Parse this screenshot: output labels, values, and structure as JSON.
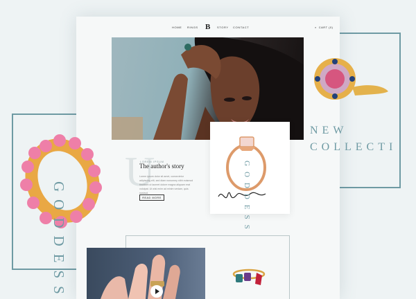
{
  "decor": {
    "vertical_big": "GODDESS",
    "vertical_small": "GODDESS",
    "new_collection_line1": "NEW",
    "new_collection_line2": "COLLECTI"
  },
  "nav": {
    "items": [
      "HOME",
      "RINGS",
      "STORY",
      "CONTACT"
    ],
    "logo": "B",
    "cart": "CART (0)"
  },
  "story": {
    "big_letter": "U",
    "caption": "LOREM IPSUM",
    "title": "The author's story",
    "body": "Lorem ipsum dolor sit amet, consectetur adipiscing elit, sed diam nonummy nibh euismod tincidunt ut laoreet dolore magna aliquam erat volutpat. Ut wisi enim ad minim veniam, quis nostrud.",
    "read_more": "READ MORE"
  },
  "colors": {
    "accent": "#6e9aa3",
    "gold": "#e0a640",
    "pink_stone": "#e86b9b"
  }
}
